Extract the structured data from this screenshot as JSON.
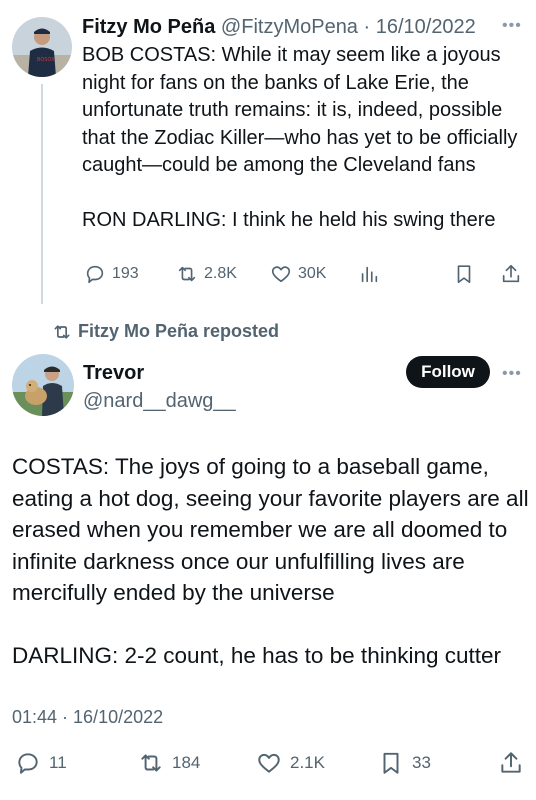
{
  "quoted_tweet": {
    "display_name": "Fitzy Mo Peña",
    "handle_date": "@FitzyMoPena · 16/10/2022",
    "more_icon": "more-dots-icon",
    "text": "BOB COSTAS: While it may seem like a joyous night for fans on the banks of Lake Erie, the unfortunate truth remains: it is, indeed, possible that the Zodiac Killer—who has yet to be officially caught—could be among the Cleveland fans\n\nRON DARLING: I think he held his swing there",
    "actions": {
      "replies": "193",
      "reposts": "2.8K",
      "likes": "30K"
    }
  },
  "repost_banner": {
    "label": "Fitzy Mo Peña reposted"
  },
  "main_tweet": {
    "display_name": "Trevor",
    "handle": "@nard__dawg__",
    "follow_label": "Follow",
    "text": "COSTAS: The joys of going to a baseball game, eating a hot dog, seeing your favorite players are all erased when you remember we are all doomed to infinite darkness once our unfulfilling lives are mercifully ended by the universe\n\nDARLING: 2-2 count, he has to be thinking cutter",
    "timestamp": "01:44 · 16/10/2022",
    "actions": {
      "replies": "11",
      "reposts": "184",
      "likes": "2.1K",
      "bookmarks": "33"
    }
  },
  "colors": {
    "text": "#0f1419",
    "secondary": "#536471",
    "follow_bg": "#0f1419",
    "thread_line": "#cfd9de"
  }
}
